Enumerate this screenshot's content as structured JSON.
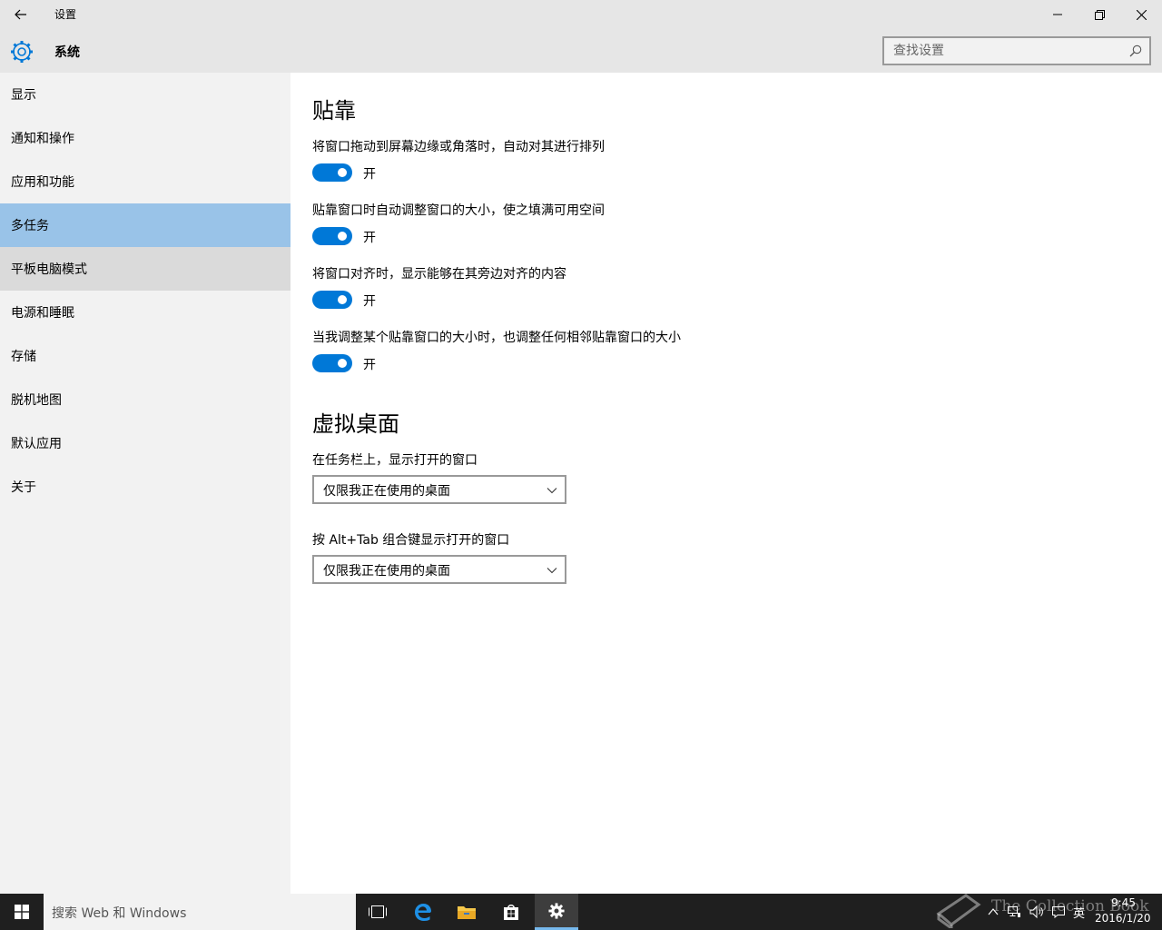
{
  "window": {
    "title": "设置",
    "back_icon": "back-arrow-icon"
  },
  "header": {
    "title": "系统",
    "search_placeholder": "查找设置"
  },
  "sidebar": {
    "items": [
      {
        "label": "显示"
      },
      {
        "label": "通知和操作"
      },
      {
        "label": "应用和功能"
      },
      {
        "label": "多任务",
        "selected": true
      },
      {
        "label": "平板电脑模式",
        "hover": true
      },
      {
        "label": "电源和睡眠"
      },
      {
        "label": "存储"
      },
      {
        "label": "脱机地图"
      },
      {
        "label": "默认应用"
      },
      {
        "label": "关于"
      }
    ]
  },
  "snap": {
    "title": "贴靠",
    "settings": [
      {
        "label": "将窗口拖动到屏幕边缘或角落时，自动对其进行排列",
        "state": "开",
        "on": true
      },
      {
        "label": "贴靠窗口时自动调整窗口的大小，使之填满可用空间",
        "state": "开",
        "on": true
      },
      {
        "label": "将窗口对齐时，显示能够在其旁边对齐的内容",
        "state": "开",
        "on": true
      },
      {
        "label": "当我调整某个贴靠窗口的大小时，也调整任何相邻贴靠窗口的大小",
        "state": "开",
        "on": true
      }
    ]
  },
  "virtual_desktops": {
    "title": "虚拟桌面",
    "taskbar_label": "在任务栏上，显示打开的窗口",
    "taskbar_value": "仅限我正在使用的桌面",
    "alttab_label": "按 Alt+Tab 组合键显示打开的窗口",
    "alttab_value": "仅限我正在使用的桌面"
  },
  "taskbar": {
    "search_text": "搜索 Web 和 Windows",
    "ime": "英",
    "time": "9:45",
    "date": "2016/1/20",
    "watermark": "The Collection Book"
  },
  "colors": {
    "accent": "#0078d7",
    "selected_item": "#99c3e8",
    "sidebar_bg": "#f2f2f2",
    "titlebar_bg": "#e6e6e6",
    "taskbar_bg": "#1f1f1f"
  }
}
